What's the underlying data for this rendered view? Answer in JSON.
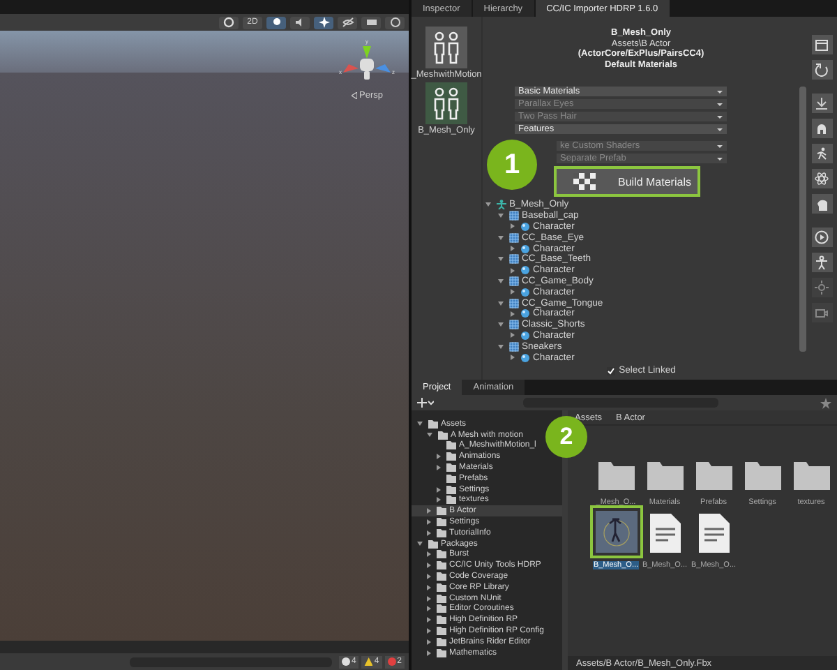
{
  "scene": {
    "toolbar": [
      {
        "kind": "shading"
      },
      {
        "kind": "text",
        "text": "2D"
      },
      {
        "kind": "light",
        "selected": true
      },
      {
        "kind": "audio",
        "selected": false
      },
      {
        "kind": "fx",
        "selected": true
      },
      {
        "kind": "hidden",
        "selected": false
      },
      {
        "kind": "camera",
        "selected": false
      },
      {
        "kind": "gizmo",
        "selected": false
      }
    ],
    "gizmo": {
      "y": "y",
      "x": "x",
      "z": "z",
      "projection": "Persp"
    },
    "console": [
      {
        "kind": "info",
        "count": "4"
      },
      {
        "kind": "warning",
        "count": "4"
      },
      {
        "kind": "error",
        "count": "2"
      }
    ]
  },
  "tabs": [
    {
      "label": "Inspector",
      "selected": false
    },
    {
      "label": "Hierarchy",
      "selected": false
    },
    {
      "label": "CC/IC Importer HDRP 1.6.0",
      "selected": true
    }
  ],
  "characters": [
    {
      "name": "_MeshwithMotion",
      "selected": false
    },
    {
      "name": "B_Mesh_Only",
      "selected": true
    }
  ],
  "header": [
    "B_Mesh_Only",
    "Assets\\B Actor",
    "(ActorCore/ExPlus/PairsCC4)",
    "Default Materials"
  ],
  "dropdown_groups": [
    {
      "items": [
        {
          "label": "Basic Materials",
          "disabled": false
        },
        {
          "label": "Parallax Eyes",
          "disabled": true
        },
        {
          "label": "Two Pass Hair",
          "disabled": true
        },
        {
          "label": "Features",
          "disabled": false
        }
      ]
    },
    {
      "items": [
        {
          "label": "ke Custom Shaders",
          "disabled": true
        },
        {
          "label": "Separate Prefab",
          "disabled": true
        }
      ]
    }
  ],
  "build_button": {
    "label": "Build Materials",
    "highlighted": true
  },
  "callouts": [
    "1",
    "2"
  ],
  "hierarchy": [
    {
      "label": "B_Mesh_Only",
      "kind": "root",
      "expanded": true,
      "children": [
        {
          "label": "Baseball_cap",
          "kind": "mesh",
          "expanded": true,
          "children": [
            {
              "label": "Character",
              "kind": "material",
              "expanded": false
            }
          ]
        },
        {
          "label": "CC_Base_Eye",
          "kind": "mesh",
          "expanded": true,
          "children": [
            {
              "label": "Character",
              "kind": "material",
              "expanded": false
            }
          ]
        },
        {
          "label": "CC_Base_Teeth",
          "kind": "mesh",
          "expanded": true,
          "children": [
            {
              "label": "Character",
              "kind": "material",
              "expanded": false
            }
          ]
        },
        {
          "label": "CC_Game_Body",
          "kind": "mesh",
          "expanded": true,
          "children": [
            {
              "label": "Character",
              "kind": "material",
              "expanded": false
            }
          ]
        },
        {
          "label": "CC_Game_Tongue",
          "kind": "mesh",
          "expanded": true,
          "children": [
            {
              "label": "Character",
              "kind": "material",
              "expanded": false
            }
          ]
        },
        {
          "label": "Classic_Shorts",
          "kind": "mesh",
          "expanded": true,
          "children": [
            {
              "label": "Character",
              "kind": "material",
              "expanded": false
            }
          ]
        },
        {
          "label": "Sneakers",
          "kind": "mesh",
          "expanded": true,
          "children": [
            {
              "label": "Character",
              "kind": "material",
              "expanded": false
            }
          ]
        }
      ]
    }
  ],
  "select_linked": {
    "label": "Select Linked",
    "checked": true
  },
  "project_tabs": [
    {
      "label": "Project",
      "selected": true
    },
    {
      "label": "Animation",
      "selected": false
    }
  ],
  "project_tree": [
    {
      "label": "Assets",
      "expanded": true,
      "selected": false,
      "children": [
        {
          "label": "A Mesh with motion",
          "expanded": true,
          "selected": false,
          "children": [
            {
              "label": "A_MeshwithMotion_l",
              "selected": false
            },
            {
              "label": "Animations",
              "expanded": false,
              "selected": false
            },
            {
              "label": "Materials",
              "expanded": false,
              "selected": false
            },
            {
              "label": "Prefabs",
              "selected": false
            },
            {
              "label": "Settings",
              "expanded": false,
              "selected": false
            },
            {
              "label": "textures",
              "expanded": false,
              "selected": false
            }
          ]
        },
        {
          "label": "B Actor",
          "expanded": false,
          "selected": true
        },
        {
          "label": "Settings",
          "expanded": false,
          "selected": false
        },
        {
          "label": "TutorialInfo",
          "expanded": false,
          "selected": false
        }
      ]
    },
    {
      "label": "Packages",
      "expanded": true,
      "selected": false,
      "children": [
        {
          "label": "Burst",
          "expanded": false,
          "selected": false
        },
        {
          "label": "CC/IC Unity Tools HDRP",
          "expanded": false,
          "selected": false
        },
        {
          "label": "Code Coverage",
          "expanded": false,
          "selected": false
        },
        {
          "label": "Core RP Library",
          "expanded": false,
          "selected": false
        },
        {
          "label": "Custom NUnit",
          "expanded": false,
          "selected": false
        },
        {
          "label": "Editor Coroutines",
          "expanded": false,
          "selected": false
        },
        {
          "label": "High Definition RP",
          "expanded": false,
          "selected": false
        },
        {
          "label": "High Definition RP Config",
          "expanded": false,
          "selected": false
        },
        {
          "label": "JetBrains Rider Editor",
          "expanded": false,
          "selected": false
        },
        {
          "label": "Mathematics",
          "expanded": false,
          "selected": false
        }
      ]
    }
  ],
  "breadcrumb": [
    "Assets",
    "B Actor"
  ],
  "assets": [
    {
      "label": "_Mesh_O...",
      "kind": "folder",
      "selected": false
    },
    {
      "label": "Materials",
      "kind": "folder",
      "selected": false
    },
    {
      "label": "Prefabs",
      "kind": "folder",
      "selected": false
    },
    {
      "label": "Settings",
      "kind": "folder",
      "selected": false
    },
    {
      "label": "textures",
      "kind": "folder",
      "selected": false
    },
    {
      "label": "B_Mesh_O...",
      "kind": "model",
      "selected": true,
      "highlighted": true
    },
    {
      "label": "B_Mesh_O...",
      "kind": "file",
      "selected": false
    },
    {
      "label": "B_Mesh_O...",
      "kind": "file",
      "selected": false
    }
  ],
  "status_path": "Assets/B Actor/B_Mesh_Only.Fbx"
}
